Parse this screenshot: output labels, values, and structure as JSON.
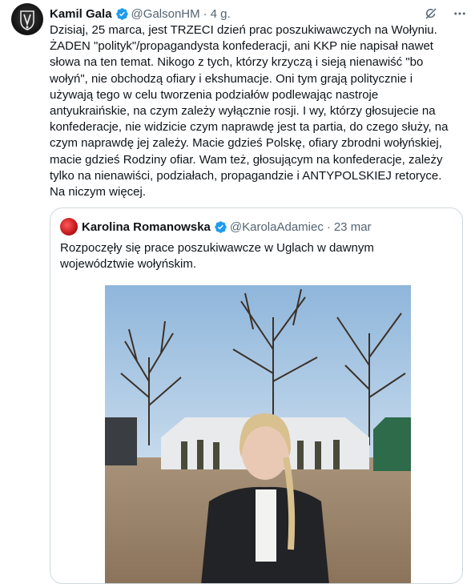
{
  "tweet": {
    "display_name": "Kamil Gala",
    "handle": "@GalsonHM",
    "separator": "·",
    "time": "4 g.",
    "text": "Dzisiaj, 25 marca, jest TRZECI dzień prac poszukiwawczych na Wołyniu.\nŻADEN \"polityk\"/propagandysta konfederacji, ani KKP nie napisał nawet\nsłowa na ten temat. Nikogo z tych, którzy krzyczą i sieją nienawiść \"bo\nwołyń\", nie obchodzą ofiary i ekshumacje. Oni tym grają politycznie i\nużywają tego w celu tworzenia podziałów podlewając nastroje\nantyukraińskie, na czym zależy wyłącznie rosji. I wy, którzy głosujecie na\nkonfederacje, nie widzicie czym naprawdę jest ta partia, do czego służy, na\nczym naprawdę jej zależy. Macie gdzieś Polskę, ofiary zbrodni wołyńskiej,\nmacie gdzieś Rodziny ofiar. Wam też, głosującym na konfederacje, zależy\ntylko na nienawiści, podziałach, propagandzie i ANTYPOLSKIEJ retoryce.\nNa niczym więcej."
  },
  "quoted": {
    "display_name": "Karolina Romanowska",
    "handle": "@KarolaAdamiec",
    "separator": "·",
    "time": "23 mar",
    "text": "Rozpoczęły się prace poszukiwawcze w Uglach w dawnym\nwojewództwie wołyńskim."
  },
  "icons": [
    "avatar-logo-icon",
    "verified-icon",
    "grok-icon",
    "more-icon"
  ],
  "colors": {
    "verified": "#1d9bf0",
    "muted": "#536471",
    "border": "#cfd9de"
  }
}
